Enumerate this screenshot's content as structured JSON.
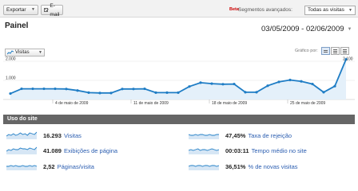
{
  "toolbar": {
    "export_label": "Exportar",
    "email_label": "E-mail",
    "beta_badge": "Beta",
    "segments_label": "Segmentos avançados:",
    "segments_value": "Todas as visitas"
  },
  "header": {
    "title": "Painel",
    "date_range": "03/05/2009 - 02/06/2009"
  },
  "graph_controls": {
    "metric": "Visitas",
    "graph_by_label": "Gráfico por:"
  },
  "colors": {
    "line": "#1f7dc5",
    "fill": "#e4f0fa",
    "header_bg": "#666666",
    "link": "#2a5db0"
  },
  "chart_data": {
    "type": "area",
    "series": [
      {
        "values": [
          310,
          560,
          560,
          560,
          560,
          550,
          470,
          360,
          340,
          340,
          550,
          550,
          560,
          360,
          360,
          360,
          680,
          880,
          830,
          800,
          810,
          380,
          380,
          720,
          920,
          1020,
          950,
          810,
          380,
          700,
          2100
        ]
      }
    ],
    "ylim": [
      0,
      2000
    ],
    "y_ticks": [
      "2.000",
      "1.000"
    ],
    "x_ticks": [
      {
        "index": 4,
        "label": "4 de maio de 2009"
      },
      {
        "index": 11,
        "label": "11 de maio de 2009"
      },
      {
        "index": 18,
        "label": "18 de maio de 2009"
      },
      {
        "index": 25,
        "label": "25 de maio de 2009"
      }
    ],
    "right_label": "2.100",
    "grid": true
  },
  "usage": {
    "title": "Uso do site",
    "stats": [
      {
        "value": "16.293",
        "label": "Visitas"
      },
      {
        "value": "41.089",
        "label": "Exibições de página"
      },
      {
        "value": "2,52",
        "label": "Páginas/visita"
      },
      {
        "value": "47,45%",
        "label": "Taxa de rejeição"
      },
      {
        "value": "00:03:11",
        "label": "Tempo médio no site"
      },
      {
        "value": "36,51%",
        "label": "% de novas visitas"
      }
    ]
  }
}
